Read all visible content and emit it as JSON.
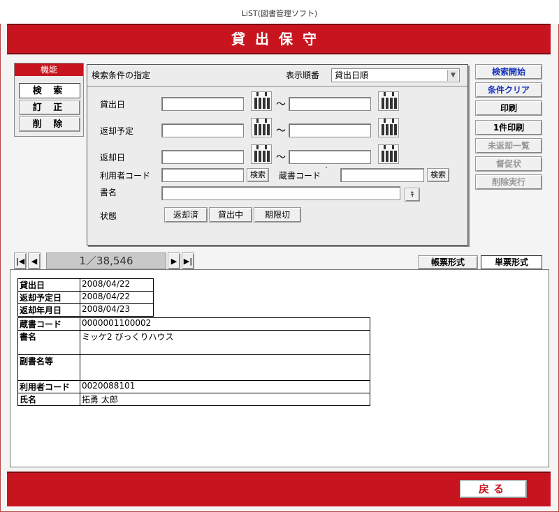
{
  "window": {
    "title": "LiST(図書管理ソフト)"
  },
  "header": {
    "title": "貸出保守"
  },
  "functions": {
    "title": "機能",
    "items": [
      {
        "label": "検 索"
      },
      {
        "label": "訂 正"
      },
      {
        "label": "削 除"
      }
    ]
  },
  "search": {
    "title": "検索条件の指定",
    "sort_label": "表示順番",
    "sort_value": "貸出日順",
    "loan_date_label": "貸出日",
    "due_date_label": "返却予定",
    "return_date_label": "返却日",
    "tilde": "～",
    "user_code_label": "利用者コード",
    "user_search_button": "検索",
    "book_code_label": "蔵書コード",
    "book_code_mark": "`",
    "book_search_button": "検索",
    "title_label": "書名",
    "kana_button": "ｷ",
    "status_label": "状態",
    "status_buttons": [
      {
        "label": "返却済"
      },
      {
        "label": "貸出中"
      },
      {
        "label": "期限切"
      }
    ]
  },
  "actions": {
    "start_search": "検索開始",
    "clear_conditions": "条件クリア",
    "print": "印刷",
    "print_one": "1件印刷",
    "unreturned_list": "未返却一覧",
    "reminder": "督促状",
    "execute_delete": "削除実行"
  },
  "navigation": {
    "record_position": "1／38,546"
  },
  "tabs": {
    "ledger": "帳票形式",
    "form": "単票形式"
  },
  "record": {
    "loan_date": {
      "label": "貸出日",
      "value": "2008/04/22"
    },
    "due_date": {
      "label": "返却予定日",
      "value": "2008/04/22"
    },
    "return_date": {
      "label": "返却年月日",
      "value": "2008/04/23"
    },
    "book_code": {
      "label": "蔵書コード",
      "value": "0000001100002"
    },
    "title": {
      "label": "書名",
      "value": "ミッケ2 びっくりハウス"
    },
    "subtitle": {
      "label": "副書名等",
      "value": ""
    },
    "user_code": {
      "label": "利用者コード",
      "value": "0020088101"
    },
    "name": {
      "label": "氏名",
      "value": "拓勇 太郎"
    }
  },
  "footer": {
    "back_button": "戻る"
  },
  "colors": {
    "accent": "#c8141e",
    "link_blue": "#1530b8"
  }
}
